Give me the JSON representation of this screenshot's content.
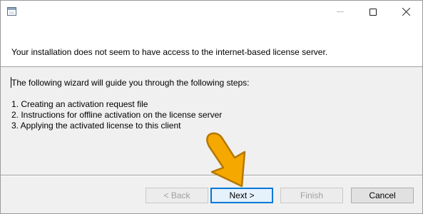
{
  "window": {
    "title": "",
    "controls": {
      "minimize_icon": "minimize-icon",
      "maximize_icon": "maximize-icon",
      "close_icon": "close-icon"
    }
  },
  "header": {
    "text": "Your installation does not seem to have access to the internet-based license server."
  },
  "body": {
    "intro": "The following wizard will guide you through the following steps:",
    "steps": [
      "1. Creating an activation request file",
      "2. Instructions for offline activation on the license server",
      "3. Applying the activated license to this client"
    ]
  },
  "buttons": {
    "back": {
      "label": "< Back",
      "enabled": false
    },
    "next": {
      "label": "Next >",
      "enabled": true,
      "focused": true
    },
    "finish": {
      "label": "Finish",
      "enabled": false
    },
    "cancel": {
      "label": "Cancel",
      "enabled": true
    }
  },
  "annotation": {
    "icon": "pointer-arrow-icon",
    "color": "#f5a800",
    "outline_color": "#b57800"
  }
}
